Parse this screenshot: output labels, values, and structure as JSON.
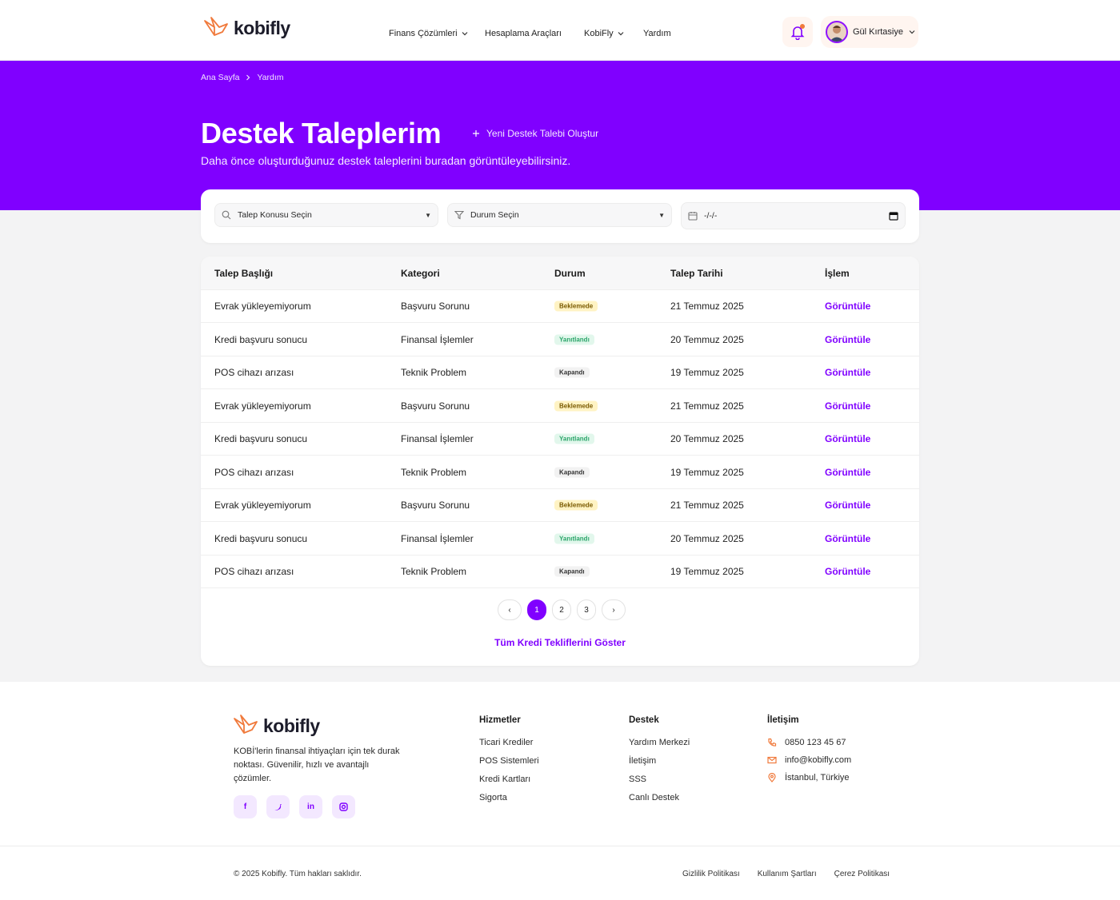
{
  "header": {
    "brand": "kobifly",
    "nav": [
      {
        "label": "Finans Çözümleri",
        "dropdown": true
      },
      {
        "label": "Hesaplama Araçları",
        "dropdown": false
      },
      {
        "label": "KobiFly",
        "dropdown": true
      },
      {
        "label": "Yardım",
        "dropdown": false
      }
    ],
    "user_name": "Gül Kırtasiye"
  },
  "colors": {
    "primary": "#8000ff",
    "accent": "#f07a3c"
  },
  "breadcrumb": {
    "home": "Ana Sayfa",
    "current": "Yardım"
  },
  "hero": {
    "title": "Destek Taleplerim",
    "new_request": "Yeni Destek Talebi Oluştur",
    "subtitle": "Daha önce oluşturduğunuz destek taleplerini buradan görüntüleyebilirsiniz."
  },
  "filters": {
    "topic": "Talep Konusu Seçin",
    "status": "Durum Seçin",
    "date": "-/-/-"
  },
  "table": {
    "headers": [
      "Talep Başlığı",
      "Kategori",
      "Durum",
      "Talep Tarihi",
      "İşlem"
    ],
    "rows": [
      {
        "title": "Evrak yükleyemiyorum",
        "category": "Başvuru Sorunu",
        "status": "Beklemede",
        "date": "21 Temmuz 2025",
        "action": "Görüntüle"
      },
      {
        "title": "Kredi başvuru sonucu",
        "category": "Finansal İşlemler",
        "status": "Yanıtlandı",
        "date": "20 Temmuz 2025",
        "action": "Görüntüle"
      },
      {
        "title": "POS cihazı arızası",
        "category": "Teknik Problem",
        "status": "Kapandı",
        "date": "19 Temmuz 2025",
        "action": "Görüntüle"
      },
      {
        "title": "Evrak yükleyemiyorum",
        "category": "Başvuru Sorunu",
        "status": "Beklemede",
        "date": "21 Temmuz 2025",
        "action": "Görüntüle"
      },
      {
        "title": "Kredi başvuru sonucu",
        "category": "Finansal İşlemler",
        "status": "Yanıtlandı",
        "date": "20 Temmuz 2025",
        "action": "Görüntüle"
      },
      {
        "title": "POS cihazı arızası",
        "category": "Teknik Problem",
        "status": "Kapandı",
        "date": "19 Temmuz 2025",
        "action": "Görüntüle"
      },
      {
        "title": "Evrak yükleyemiyorum",
        "category": "Başvuru Sorunu",
        "status": "Beklemede",
        "date": "21 Temmuz 2025",
        "action": "Görüntüle"
      },
      {
        "title": "Kredi başvuru sonucu",
        "category": "Finansal İşlemler",
        "status": "Yanıtlandı",
        "date": "20 Temmuz 2025",
        "action": "Görüntüle"
      },
      {
        "title": "POS cihazı arızası",
        "category": "Teknik Problem",
        "status": "Kapandı",
        "date": "19 Temmuz 2025",
        "action": "Görüntüle"
      }
    ]
  },
  "pagination": {
    "prev": "‹",
    "pages": [
      "1",
      "2",
      "3"
    ],
    "current": "1",
    "next": "›"
  },
  "show_all": "Tüm Kredi Tekliflerini Göster",
  "footer": {
    "brand": "kobifly",
    "description": "KOBİ'lerin finansal ihtiyaçları için tek durak noktası. Güvenilir, hızlı ve avantajlı çözümler.",
    "socials": [
      "f",
      "t",
      "in",
      "ig"
    ],
    "services": {
      "title": "Hizmetler",
      "links": [
        "Ticari Krediler",
        "POS Sistemleri",
        "Kredi Kartları",
        "Sigorta"
      ]
    },
    "support": {
      "title": "Destek",
      "links": [
        "Yardım Merkezi",
        "İletişim",
        "SSS",
        "Canlı Destek"
      ]
    },
    "contact": {
      "title": "İletişim",
      "phone": "0850 123 45 67",
      "email": "info@kobifly.com",
      "location": "İstanbul, Türkiye"
    },
    "copyright": "© 2025 Kobifly. Tüm hakları saklıdır.",
    "legal": [
      "Gizlilik Politikası",
      "Kullanım Şartları",
      "Çerez Politikası"
    ]
  }
}
